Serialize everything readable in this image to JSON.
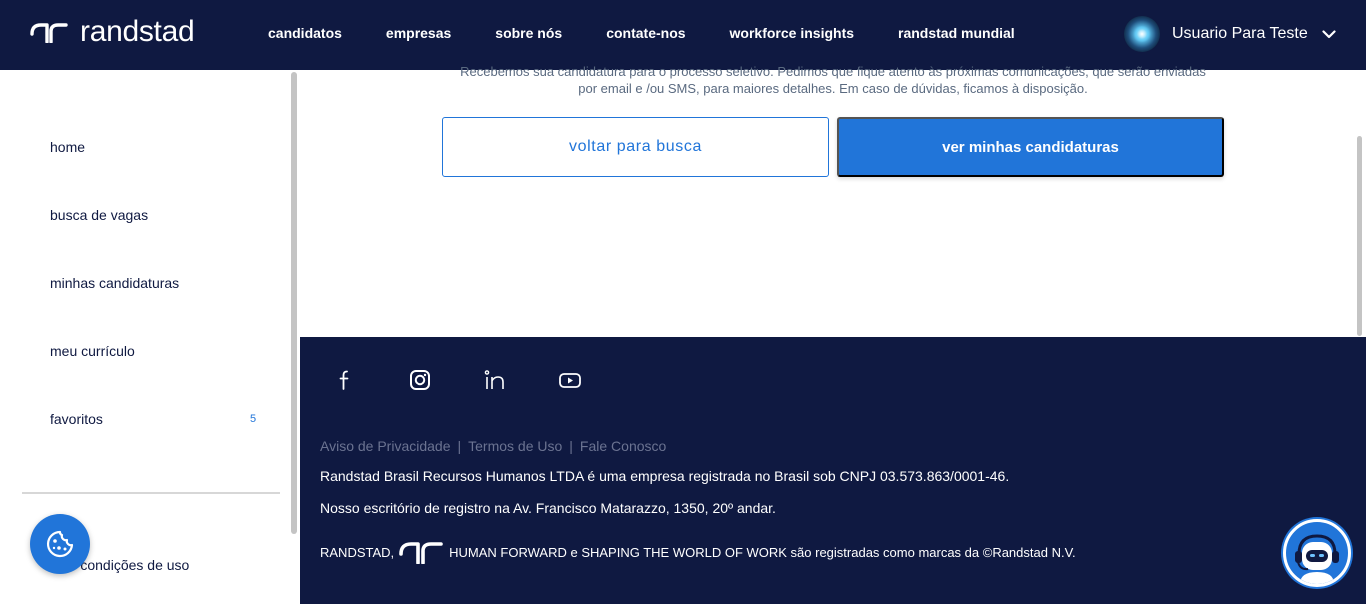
{
  "header": {
    "brand": "randstad",
    "nav": [
      {
        "label": "candidatos"
      },
      {
        "label": "empresas"
      },
      {
        "label": "sobre nós"
      },
      {
        "label": "contate-nos"
      },
      {
        "label": "workforce insights"
      },
      {
        "label": "randstad mundial"
      }
    ],
    "user_name": "Usuario Para Teste"
  },
  "sidebar": {
    "items": [
      {
        "label": "home"
      },
      {
        "label": "busca de vagas"
      },
      {
        "label": "minhas candidaturas"
      },
      {
        "label": "meu currículo"
      },
      {
        "label": "favoritos",
        "count": "5"
      }
    ],
    "terms_label": "os e condições de uso"
  },
  "main": {
    "message_line1": "Recebemos sua candidatura para o processo seletivo. Pedimos que fique atento às próximas comunicações, que serão enviadas",
    "message_line2": "por email e /ou SMS, para maiores detalhes. Em caso de dúvidas, ficamos à disposição.",
    "back_button": "voltar para busca",
    "applications_button": "ver minhas candidaturas"
  },
  "footer": {
    "social_icons": [
      "facebook-icon",
      "instagram-icon",
      "linkedin-icon",
      "youtube-icon"
    ],
    "links": [
      {
        "label": "Aviso de Privacidade"
      },
      {
        "label": "Termos de Uso"
      },
      {
        "label": "Fale Conosco"
      }
    ],
    "separator": "|",
    "company_line": "Randstad Brasil Recursos Humanos LTDA é uma empresa registrada no Brasil sob CNPJ 03.573.863/0001-46.",
    "address_line": "Nosso escritório de registro na Av. Francisco Matarazzo, 1350, 20º andar.",
    "trademark_prefix": "RANDSTAD,",
    "trademark_suffix": "HUMAN FORWARD e SHAPING THE WORLD OF WORK são registradas como marcas da ©Randstad N.V."
  },
  "colors": {
    "navy": "#0f1941",
    "accent_blue": "#2175d9",
    "white": "#ffffff"
  }
}
